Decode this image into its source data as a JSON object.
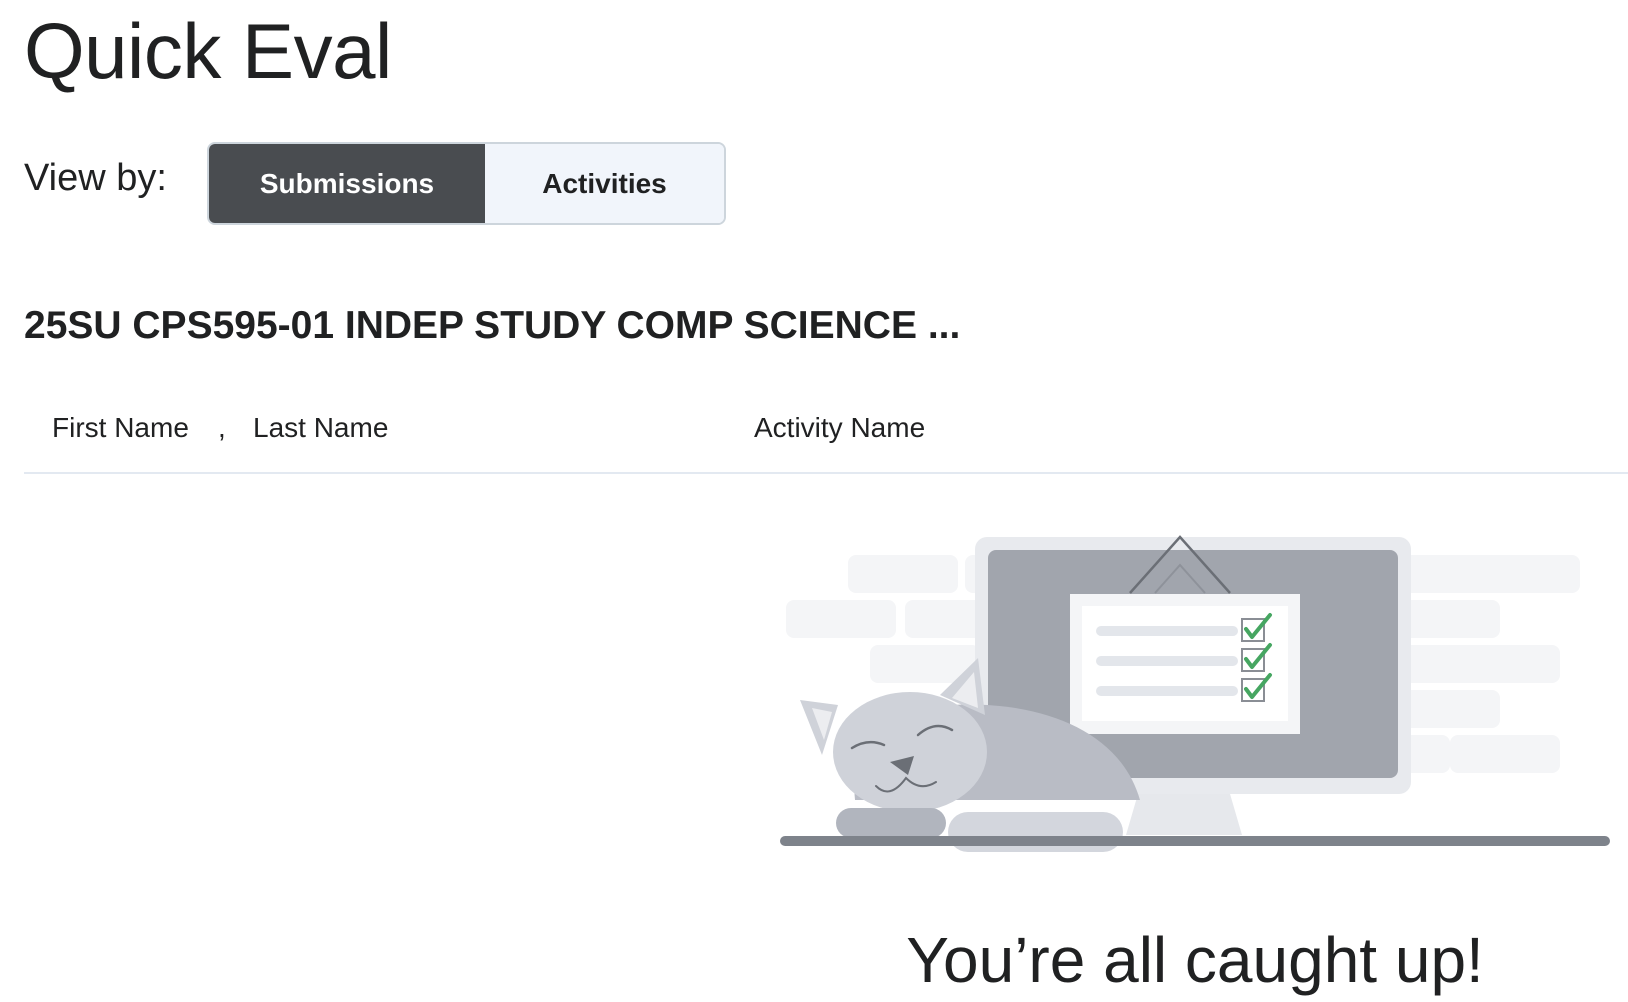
{
  "page": {
    "title": "Quick Eval"
  },
  "view_by": {
    "label": "View by:",
    "options": [
      {
        "label": "Submissions",
        "selected": true
      },
      {
        "label": "Activities",
        "selected": false
      }
    ]
  },
  "course": {
    "heading": "25SU CPS595-01 INDEP STUDY COMP SCIENCE ..."
  },
  "table": {
    "columns": {
      "first_name": "First Name",
      "separator": ",",
      "last_name": "Last Name",
      "activity_name": "Activity Name"
    },
    "rows": []
  },
  "empty_state": {
    "illustration": "sleeping-cat-monitor-checklist-icon",
    "message": "You’re all caught up!"
  },
  "colors": {
    "selected_toggle_bg": "#494c50",
    "unselected_toggle_bg": "#f1f5fb",
    "checkmark": "#46a661",
    "text": "#202122"
  }
}
